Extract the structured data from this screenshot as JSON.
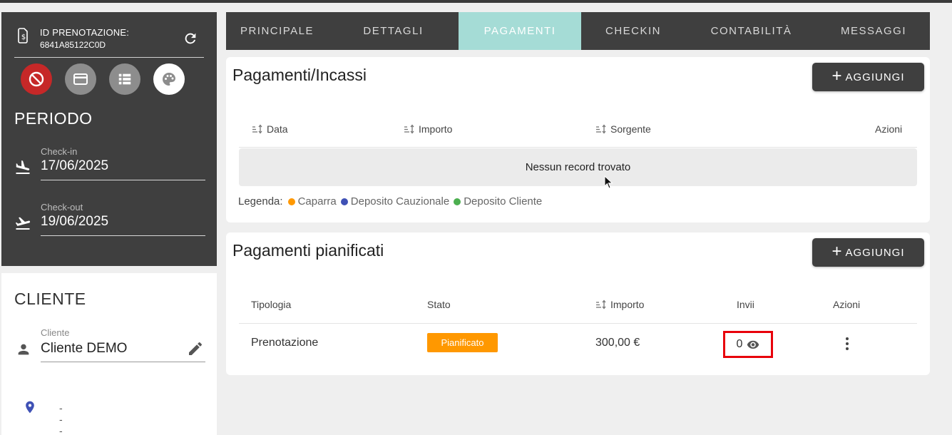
{
  "booking": {
    "id_label": "ID PRENOTAZIONE:",
    "id_value": "6841A85122C0D"
  },
  "action_icons": [
    "block-icon",
    "credit-card-icon",
    "list-icon",
    "palette-icon"
  ],
  "period": {
    "title": "PERIODO",
    "checkin_label": "Check-in",
    "checkin_value": "17/06/2025",
    "checkout_label": "Check-out",
    "checkout_value": "19/06/2025"
  },
  "client": {
    "title": "CLIENTE",
    "label": "Cliente",
    "value": "Cliente DEMO",
    "location": "---"
  },
  "tabs": [
    {
      "label": "PRINCIPALE",
      "active": false
    },
    {
      "label": "DETTAGLI",
      "active": false
    },
    {
      "label": "PAGAMENTI",
      "active": true
    },
    {
      "label": "CHECKIN",
      "active": false
    },
    {
      "label": "CONTABILITÀ",
      "active": false
    },
    {
      "label": "MESSAGGI",
      "active": false
    }
  ],
  "payments": {
    "title": "Pagamenti/Incassi",
    "add_label": "AGGIUNGI",
    "columns": {
      "data": "Data",
      "importo": "Importo",
      "sorgente": "Sorgente",
      "azioni": "Azioni"
    },
    "empty_message": "Nessun record trovato",
    "legend": {
      "title": "Legenda:",
      "items": [
        {
          "label": "Caparra",
          "color": "#ff9800"
        },
        {
          "label": "Deposito Cauzionale",
          "color": "#3f51b5"
        },
        {
          "label": "Deposito Cliente",
          "color": "#4caf50"
        }
      ]
    }
  },
  "planned": {
    "title": "Pagamenti pianificati",
    "add_label": "AGGIUNGI",
    "columns": {
      "tipologia": "Tipologia",
      "stato": "Stato",
      "importo": "Importo",
      "invii": "Invii",
      "azioni": "Azioni"
    },
    "rows": [
      {
        "tipologia": "Prenotazione",
        "stato": "Pianificato",
        "importo": "300,00 €",
        "invii": "0"
      }
    ]
  },
  "colors": {
    "dark_panel": "#3f3f3f",
    "active_tab": "#a5dcd6",
    "status_badge": "#ff9800",
    "highlight": "#e8000b",
    "danger": "#c62828"
  }
}
